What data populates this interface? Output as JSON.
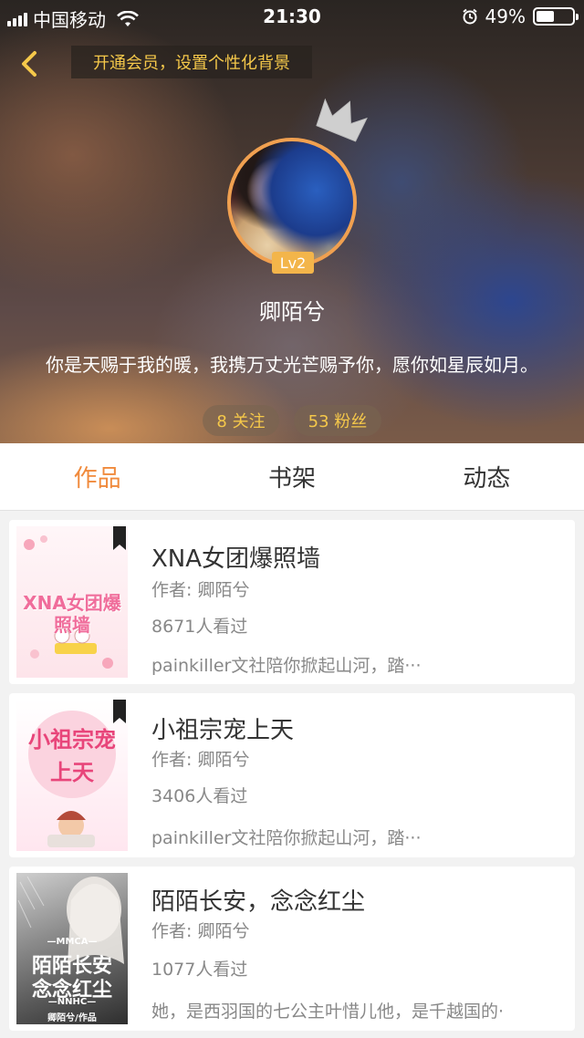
{
  "status_bar": {
    "carrier": "中国移动",
    "time": "21:30",
    "battery": "49%",
    "battery_level": 0.49
  },
  "header": {
    "vip_banner": "开通会员，设置个性化背景",
    "level": "Lv2",
    "username": "卿陌兮",
    "bio": "你是天赐于我的暖，我携万丈光芒赐予你，愿你如星辰如月。",
    "following": "8 关注",
    "followers": "53 粉丝",
    "accent_color": "#f5c84a"
  },
  "tabs": [
    {
      "label": "作品",
      "active": true
    },
    {
      "label": "书架",
      "active": false
    },
    {
      "label": "动态",
      "active": false
    }
  ],
  "books": [
    {
      "title": "XNA女团爆照墙",
      "author": "作者: 卿陌兮",
      "views": "8671人看过",
      "desc": "painkiller文社陪你掀起山河，踏···",
      "cover_text": "XNA女团爆照墙"
    },
    {
      "title": "小祖宗宠上天",
      "author": "作者: 卿陌兮",
      "views": "3406人看过",
      "desc": "painkiller文社陪你掀起山河，踏···",
      "cover_text": "小祖宗宠上天"
    },
    {
      "title": "陌陌长安，念念红尘",
      "author": "作者: 卿陌兮",
      "views": "1077人看过",
      "desc": "她，是西羽国的七公主叶惜儿他，是千越国的·",
      "cover_top": "—MMCA—",
      "cover_line1": "陌陌长安",
      "cover_line2": "念念红尘",
      "cover_sub": "—NNHC—",
      "cover_author": "卿陌兮/作品"
    }
  ],
  "colors": {
    "tab_active": "#f08a3c",
    "avatar_ring": "#f0a050",
    "level_badge": "#f3b54a"
  }
}
